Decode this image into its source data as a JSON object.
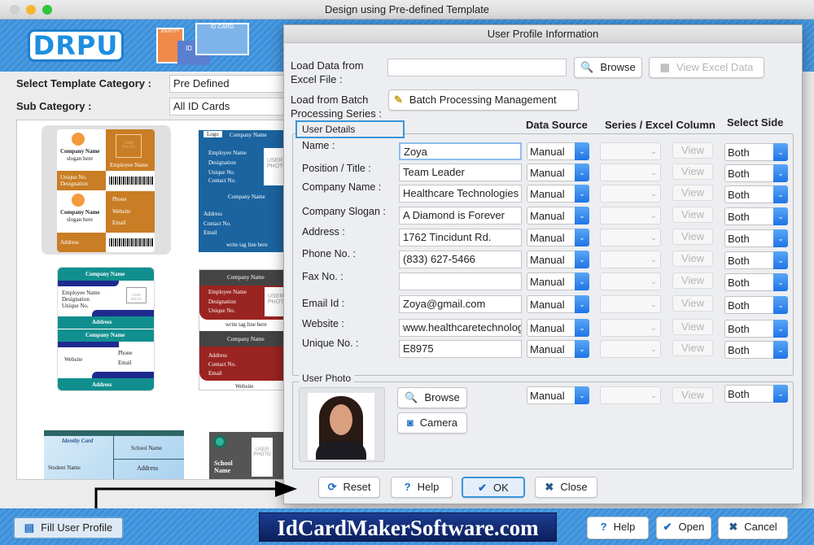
{
  "window": {
    "title": "Design using Pre-defined Template"
  },
  "brand": {
    "logo_text": "DRPU",
    "id_card_graphic": "ID CARD",
    "id_small": "ID",
    "identity_small": "IDENTITY",
    "accent": "#1f74e6"
  },
  "left": {
    "template_category_label": "Select Template Category :",
    "template_category_value": "Pre Defined",
    "sub_category_label": "Sub Category :",
    "sub_category_value": "All ID Cards"
  },
  "templates": {
    "t1": {
      "company": "Company Name",
      "slogan": "slogan here",
      "photo": "USER PHOTO",
      "employee": "Employee Name",
      "unique": "Unique No.",
      "designation": "Designation",
      "phone": "Phone",
      "website": "Website",
      "email": "Email",
      "address": "Address"
    },
    "t2": {
      "logo": "Logo",
      "company": "Company Name",
      "employee": "Employee Name",
      "designation": "Designation",
      "unique": "Unique No.",
      "contact": "Contact No.",
      "photo": "USER PHOTO",
      "address": "Address",
      "email": "Email",
      "tagline": "write tag line here"
    },
    "t3": {
      "company": "Company Name",
      "employee": "Employee Name",
      "designation": "Designation",
      "unique": "Unique No.",
      "photo": "USER PHOTO",
      "address": "Address",
      "website": "Website",
      "phone": "Phone",
      "email": "Email"
    },
    "t4": {
      "company": "Company Name",
      "employee": "Employee Name",
      "designation": "Designation",
      "unique": "Unique No.",
      "photo": "USER PHOTO",
      "tagline": "write tag line here",
      "address": "Address",
      "contact": "Contact No.",
      "email": "Email",
      "website": "Website"
    },
    "t5": {
      "identity": "Identity Card",
      "school": "School Name",
      "student": "Student Name",
      "address": "Address"
    },
    "t6": {
      "school": "School Name",
      "photo": "USER PHOTO"
    }
  },
  "dialog": {
    "title": "User Profile Information",
    "load_excel_label": "Load Data from Excel File :",
    "excel_path": "",
    "browse": "Browse",
    "view_excel": "View Excel Data",
    "load_batch_label": "Load from Batch Processing Series :",
    "batch_button": "Batch Processing Management",
    "user_details": "User Details",
    "col_data_source": "Data Source",
    "col_series": "Series / Excel Column",
    "col_side": "Select Side",
    "fields": [
      {
        "label": "Name :",
        "value": "Zoya",
        "source": "Manual",
        "view": "View",
        "side": "Both"
      },
      {
        "label": "Position / Title :",
        "value": "Team Leader",
        "source": "Manual",
        "view": "View",
        "side": "Both"
      },
      {
        "label": "Company Name :",
        "value": "Healthcare Technologies",
        "source": "Manual",
        "view": "View",
        "side": "Both"
      },
      {
        "label": "Company Slogan :",
        "value": "A Diamond is Forever",
        "source": "Manual",
        "view": "View",
        "side": "Both"
      },
      {
        "label": "Address :",
        "value": "1762 Tincidunt Rd.",
        "source": "Manual",
        "view": "View",
        "side": "Both"
      },
      {
        "label": "Phone No. :",
        "value": "(833) 627-5466",
        "source": "Manual",
        "view": "View",
        "side": "Both"
      },
      {
        "label": "Fax No. :",
        "value": "",
        "source": "Manual",
        "view": "View",
        "side": "Both"
      },
      {
        "label": "Email Id :",
        "value": "Zoya@gmail.com",
        "source": "Manual",
        "view": "View",
        "side": "Both"
      },
      {
        "label": "Website :",
        "value": "www.healthcaretechnologies.com",
        "source": "Manual",
        "view": "View",
        "side": "Both"
      },
      {
        "label": "Unique No. :",
        "value": "E8975",
        "source": "Manual",
        "view": "View",
        "side": "Both"
      }
    ],
    "user_photo": "User Photo",
    "photo_browse": "Browse",
    "photo_camera": "Camera",
    "photo_source": "Manual",
    "photo_view": "View",
    "photo_side": "Both",
    "reset": "Reset",
    "help": "Help",
    "ok": "OK",
    "close": "Close"
  },
  "bottom": {
    "fill_profile": "Fill User Profile",
    "website": "IdCardMakerSoftware.com",
    "help": "Help",
    "open": "Open",
    "cancel": "Cancel"
  }
}
